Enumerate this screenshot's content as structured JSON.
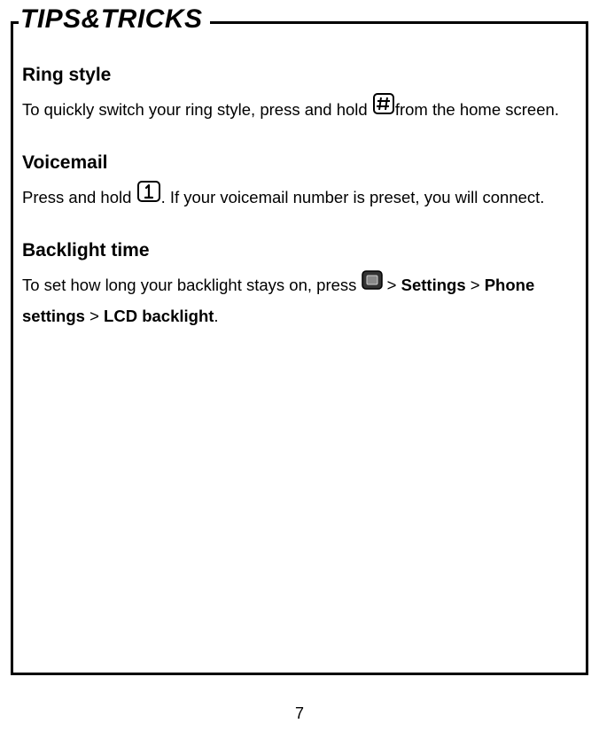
{
  "page": {
    "title": "TIPS&TRICKS",
    "number": "7"
  },
  "sections": {
    "ring": {
      "heading": "Ring style",
      "t1": "To quickly switch your ring style, press and hold",
      "t2": "from the home screen."
    },
    "voicemail": {
      "heading": "Voicemail",
      "t1": "Press and hold",
      "t2": ". If your voicemail number is preset, you will connect."
    },
    "backlight": {
      "heading": "Backlight time",
      "t1": "To set how long your backlight stays on, press ",
      "gt1": " > ",
      "b1": "Settings",
      "gt2": " > ",
      "b2": "Phone settings",
      "gt3": " > ",
      "b3": "LCD backlight",
      "end": "."
    }
  }
}
